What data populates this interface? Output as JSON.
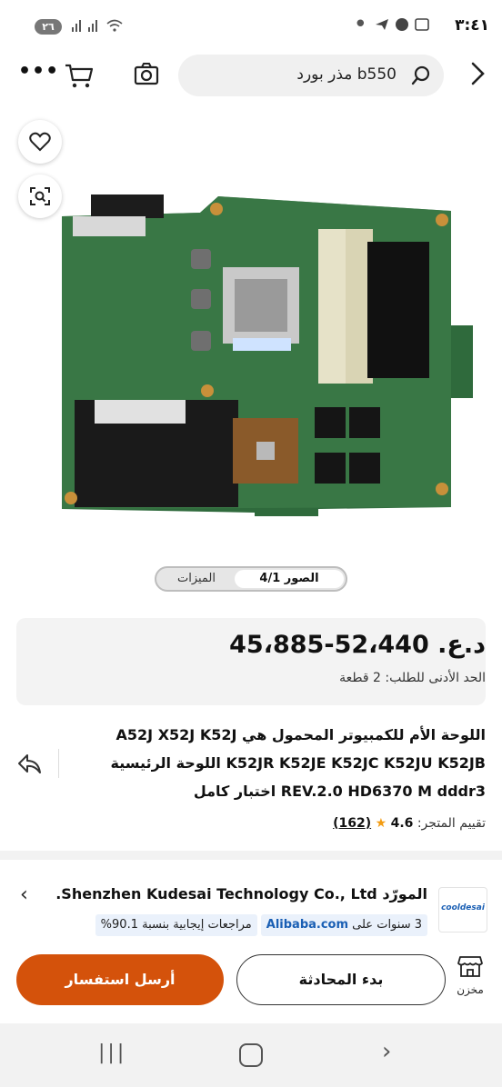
{
  "status_bar": {
    "time": "٣:٤١",
    "battery": "٢٦"
  },
  "search": {
    "query": "مذر بورد b550"
  },
  "gallery": {
    "pager_photos": "الصور 4/1",
    "pager_features": "الميزات",
    "image_alt": "Laptop motherboard K52JR"
  },
  "price": {
    "range": "52،440-45،885",
    "currency": "د.ع.",
    "min_order": "الحد الأدنى للطلب: 2 قطعة"
  },
  "product": {
    "title": "اللوحة الأم للكمبيوتر المحمول هي A52J X52J K52J K52JR K52JE K52JC K52JU K52JB اللوحة الرئيسية REV.2.0 HD6370 M dddr3 اختبار كامل",
    "rating_label": "تقييم المتجر:",
    "rating_value": "4.6",
    "rating_count": "(162)"
  },
  "supplier": {
    "label": "المورّد",
    "name": "Shenzhen Kudesai Technology Co., Ltd.",
    "logo_text": "cooldesai",
    "years": "3 سنوات على",
    "platform": "Alibaba.com",
    "positive_reviews": "مراجعات إيجابية بنسبة 90.1%"
  },
  "actions": {
    "store": "مخزن",
    "chat": "بدء المحادثة",
    "inquiry": "أرسل استفسار"
  },
  "colors": {
    "accent": "#d4520b",
    "blue": "#1a5fb4"
  }
}
